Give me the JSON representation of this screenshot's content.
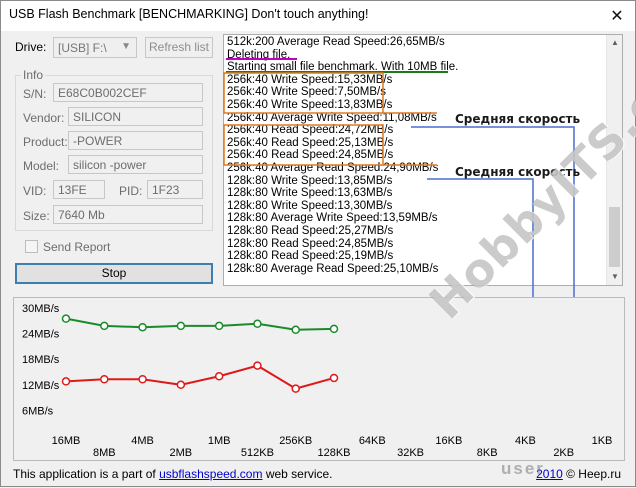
{
  "window": {
    "title": "USB Flash Benchmark [BENCHMARKING] Don't touch anything!",
    "close_glyph": "✕"
  },
  "drive": {
    "label": "Drive:",
    "value": "[USB] F:\\",
    "refresh_label": "Refresh list"
  },
  "info": {
    "legend": "Info",
    "fields": [
      {
        "label": "S/N:",
        "value": "E68C0B002CEF"
      },
      {
        "label": "Vendor:",
        "value": "SILICON"
      },
      {
        "label": "Product:",
        "value": "-POWER"
      },
      {
        "label": "Model:",
        "value": "silicon -power"
      },
      {
        "label": "Size:",
        "value": "7640 Mb"
      }
    ],
    "vid_label": "VID:",
    "vid_value": "13FE",
    "pid_label": "PID:",
    "pid_value": "1F23"
  },
  "send_report_label": "Send Report",
  "stop_label": "Stop",
  "log": {
    "lines": [
      "512k:200 Average Read Speed:26,65MB/s",
      "Deleting file.",
      "Starting small file benchmark. With 10MB file.",
      "256k:40 Write Speed:15,33MB/s",
      "256k:40 Write Speed:7,50MB/s",
      "256k:40 Write Speed:13,83MB/s",
      "256k:40 Average Write Speed:11,08MB/s",
      "256k:40 Read Speed:24,72MB/s",
      "256k:40 Read Speed:25,13MB/s",
      "256k:40 Read Speed:24,85MB/s",
      "256k:40 Average Read Speed:24,90MB/s",
      "128k:80 Write Speed:13,85MB/s",
      "128k:80 Write Speed:13,63MB/s",
      "128k:80 Write Speed:13,30MB/s",
      "128k:80 Average Write Speed:13,59MB/s",
      "128k:80 Read Speed:25,27MB/s",
      "128k:80 Read Speed:24,85MB/s",
      "128k:80 Read Speed:25,19MB/s",
      "128k:80 Average Read Speed:25,10MB/s"
    ],
    "highlight_colors": {
      "deleting": "#c000c0",
      "starting": "#1a7a1a",
      "write_box": "#e07820",
      "read_box": "#e07820",
      "connector": "#4a6fd0"
    }
  },
  "annotations": {
    "avg_speed_1": "Средняя скорость",
    "avg_speed_2": "Средняя скорость"
  },
  "chart_data": {
    "type": "line",
    "categories": [
      "16MB",
      "8MB",
      "4MB",
      "2MB",
      "1MB",
      "512KB",
      "256KB",
      "128KB",
      "64KB",
      "32KB",
      "16KB",
      "8KB",
      "4KB",
      "2KB",
      "1KB"
    ],
    "y_tick_labels": [
      "30MB/s",
      "24MB/s",
      "18MB/s",
      "12MB/s",
      "6MB/s"
    ],
    "ylim": [
      0,
      30
    ],
    "grid": false,
    "series": [
      {
        "color": "#1a8a2a",
        "values": [
          27.5,
          25.8,
          25.5,
          25.8,
          25.8,
          26.3,
          24.9,
          25.1
        ]
      },
      {
        "color": "#dd1a1a",
        "values": [
          12.8,
          13.3,
          13.3,
          12.0,
          14.0,
          16.5,
          11.1,
          13.6
        ]
      }
    ],
    "highlight_category": "256KB"
  },
  "footer": {
    "prefix": "This application is a part of ",
    "link": "usbflashspeed.com",
    "suffix": " web service.",
    "copyright_year": "2010",
    "copyright_author": " © Heep.ru"
  },
  "watermark": {
    "text": "HobbyITS.com",
    "bottom_text": "user"
  }
}
